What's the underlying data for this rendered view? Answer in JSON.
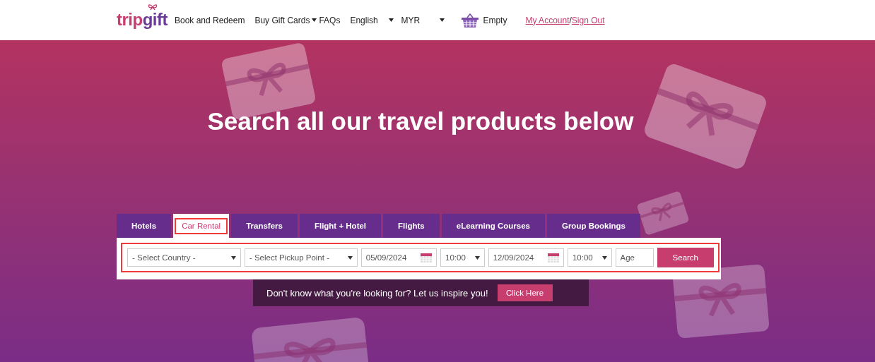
{
  "header": {
    "logo": [
      "trip",
      "gift"
    ],
    "nav": [
      {
        "label": "Book and Redeem",
        "kind": "link"
      },
      {
        "label": "Buy Gift Cards",
        "kind": "dropdown"
      },
      {
        "label": "FAQs",
        "kind": "link"
      }
    ],
    "selects": [
      {
        "value": "English"
      },
      {
        "value": "MYR"
      }
    ],
    "cart": "Empty",
    "account_links": [
      "My Account",
      "Sign Out"
    ],
    "separator": "/"
  },
  "hero": {
    "title": "Search all our travel products below"
  },
  "tabs": [
    {
      "label": "Hotels",
      "selected": false,
      "highlighted": false
    },
    {
      "label": "Car Rental",
      "selected": true,
      "highlighted": true
    },
    {
      "label": "Transfers",
      "selected": false,
      "highlighted": false
    },
    {
      "label": "Flight + Hotel",
      "selected": false,
      "highlighted": false
    },
    {
      "label": "Flights",
      "selected": false,
      "highlighted": false
    },
    {
      "label": "eLearning Courses",
      "selected": false,
      "highlighted": false
    },
    {
      "label": "Group Bookings",
      "selected": false,
      "highlighted": false
    }
  ],
  "search_form": {
    "highlighted": true,
    "fields": [
      {
        "kind": "select",
        "value": "- Select Country -"
      },
      {
        "kind": "select",
        "value": "- Select Pickup Point -"
      },
      {
        "kind": "date",
        "value": "05/09/2024"
      },
      {
        "kind": "select",
        "value": "10:00"
      },
      {
        "kind": "date",
        "value": "12/09/2024"
      },
      {
        "kind": "select",
        "value": "10:00"
      },
      {
        "kind": "input",
        "placeholder": "Age"
      }
    ],
    "button": "Search"
  },
  "inspire": {
    "text": "Don't know what you're looking for? Let us inspire you!",
    "button": "Click Here"
  }
}
